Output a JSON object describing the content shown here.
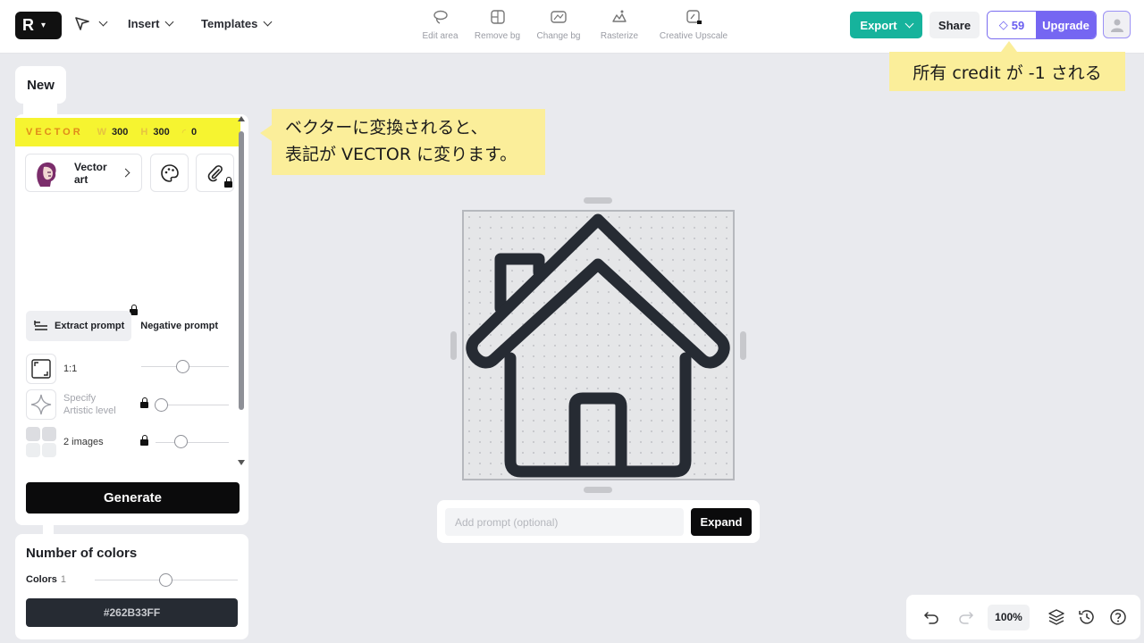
{
  "header": {
    "logo_text": "R",
    "insert_label": "Insert",
    "templates_label": "Templates",
    "tools": [
      {
        "label": "Edit area",
        "icon": "lasso-icon"
      },
      {
        "label": "Remove bg",
        "icon": "remove-bg-icon"
      },
      {
        "label": "Change bg",
        "icon": "change-bg-icon"
      },
      {
        "label": "Rasterize",
        "icon": "rasterize-icon"
      },
      {
        "label": "Creative Upscale",
        "icon": "upscale-icon"
      }
    ],
    "export_label": "Export",
    "share_label": "Share",
    "credits": "59",
    "upgrade_label": "Upgrade"
  },
  "annotations": {
    "credit_note": "所有 credit が -1 される",
    "vector_note_line1": "ベクターに変換されると、",
    "vector_note_line2": "表記が VECTOR に変ります。"
  },
  "left_panel": {
    "tab_label": "New",
    "type_label": "VECTOR",
    "w_label": "W",
    "w_value": "300",
    "h_label": "H",
    "h_value": "300",
    "r_label": "◜",
    "r_value": "0",
    "style_name": "Vector art",
    "extract_prompt_label": "Extract prompt",
    "negative_prompt_label": "Negative prompt",
    "ratio_label": "1:1",
    "artistic_label_1": "Specify",
    "artistic_label_2": "Artistic level",
    "images_label": "2 images",
    "generate_label": "Generate"
  },
  "colors_panel": {
    "title": "Number of colors",
    "colors_label": "Colors",
    "colors_value": "1",
    "hex": "#262B33FF"
  },
  "canvas": {
    "prompt_placeholder": "Add prompt (optional)",
    "expand_label": "Expand"
  },
  "bottom_bar": {
    "zoom": "100%"
  },
  "colors": {
    "accent_export": "#16b39c",
    "accent_upgrade": "#7566f2",
    "callout": "#fbee9a",
    "vector_bar": "#f6f430",
    "stroke": "#262b33"
  }
}
